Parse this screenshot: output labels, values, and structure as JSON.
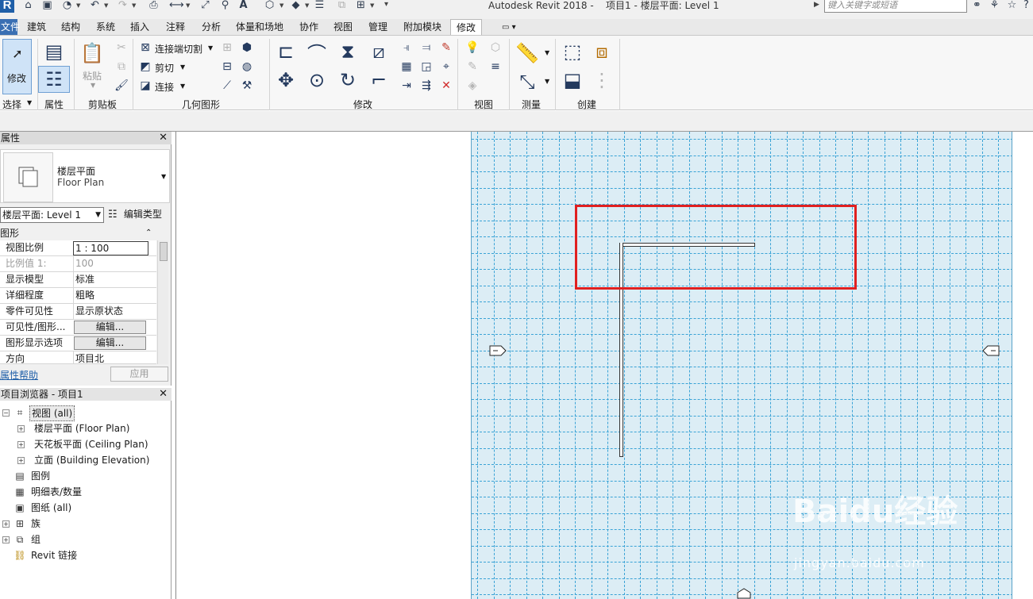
{
  "titlebar": {
    "app_title": "Autodesk Revit 2018 -",
    "doc_title": "项目1 - 楼层平面: Level 1",
    "search_placeholder": "键入关键字或短语"
  },
  "tabs": [
    "文件",
    "建筑",
    "结构",
    "系统",
    "插入",
    "注释",
    "分析",
    "体量和场地",
    "协作",
    "视图",
    "管理",
    "附加模块",
    "修改"
  ],
  "active_tab": "修改",
  "ribbon": {
    "select": {
      "modify_label": "修改",
      "group_label": "选择"
    },
    "properties": {
      "group_label": "属性"
    },
    "clipboard": {
      "paste_label": "粘贴",
      "group_label": "剪贴板"
    },
    "geometry": {
      "cut_join_label": "连接端切割",
      "cut_label": "剪切",
      "join_label": "连接",
      "group_label": "几何图形"
    },
    "modify": {
      "group_label": "修改"
    },
    "view": {
      "group_label": "视图"
    },
    "measure": {
      "group_label": "测量"
    },
    "create": {
      "group_label": "创建"
    }
  },
  "properties_palette": {
    "title": "属性",
    "type_name_cn": "楼层平面",
    "type_name_en": "Floor Plan",
    "view_selector": "楼层平面: Level 1",
    "edit_type": "编辑类型",
    "section": "图形",
    "rows": [
      {
        "key": "视图比例",
        "value": "1 : 100"
      },
      {
        "key": "比例值 1:",
        "value": "100"
      },
      {
        "key": "显示模型",
        "value": "标准"
      },
      {
        "key": "详细程度",
        "value": "粗略"
      },
      {
        "key": "零件可见性",
        "value": "显示原状态"
      },
      {
        "key": "可见性/图形...",
        "value": "编辑..."
      },
      {
        "key": "图形显示选项",
        "value": "编辑..."
      },
      {
        "key": "方向",
        "value": "项目北"
      }
    ],
    "help_link": "属性帮助",
    "apply": "应用"
  },
  "project_browser": {
    "title": "项目浏览器 - 项目1",
    "items": [
      {
        "label": "视图 (all)"
      },
      {
        "label": "楼层平面 (Floor Plan)"
      },
      {
        "label": "天花板平面 (Ceiling Plan)"
      },
      {
        "label": "立面 (Building Elevation)"
      },
      {
        "label": "图例"
      },
      {
        "label": "明细表/数量"
      },
      {
        "label": "图纸 (all)"
      },
      {
        "label": "族"
      },
      {
        "label": "组"
      },
      {
        "label": "Revit 链接"
      }
    ]
  },
  "watermark": {
    "brand": "Baidu经验",
    "url": "jingyan.baidu.com"
  },
  "colors": {
    "grid_bg": "#dcedf5",
    "grid_line": "#3aa3d6",
    "highlight": "#e02020",
    "tab_file": "#3a6fb3",
    "selection": "#cfe3f7"
  }
}
